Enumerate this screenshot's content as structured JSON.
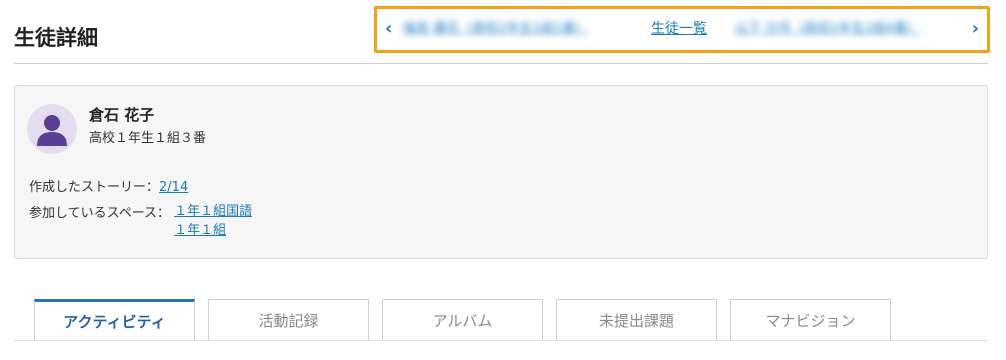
{
  "header": {
    "title": "生徒詳細"
  },
  "navigation": {
    "prev_arrow": "‹",
    "prev_student": "福島 優花（高校1年生1組1番）",
    "list_label": "生徒一覧",
    "next_student": "山下 沙月（高校1年生1組4番）",
    "next_arrow": "›",
    "highlight_color": "#f0a31a"
  },
  "student": {
    "name": "倉石 花子",
    "class": "高校１年生１組３番",
    "stories_label": "作成したストーリー：",
    "stories_value": "2/14",
    "spaces_label": "参加しているスペース：",
    "spaces": [
      "１年１組国語",
      "１年１組"
    ]
  },
  "tabs": [
    {
      "label": "アクティビティ",
      "active": true
    },
    {
      "label": "活動記録",
      "active": false
    },
    {
      "label": "アルバム",
      "active": false
    },
    {
      "label": "未提出課題",
      "active": false
    },
    {
      "label": "マナビジョン",
      "active": false
    }
  ]
}
